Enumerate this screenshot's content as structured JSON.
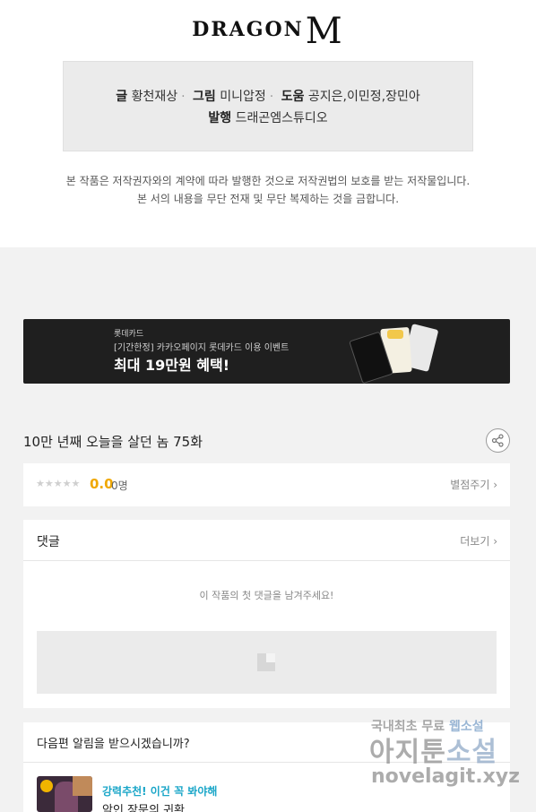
{
  "logo": {
    "text": "DRAGON",
    "mark": "M"
  },
  "credits": {
    "writer_label": "글",
    "writer": "황천재상",
    "art_label": "그림",
    "art": "미니압정",
    "assist_label": "도움",
    "assist": "공지은,이민정,장민아",
    "publisher_label": "발행",
    "publisher": "드래곤엠스튜디오"
  },
  "notice": {
    "line1": "본 작품은 저작권자와의 계약에 따라 발행한 것으로 저작권법의 보호를 받는 저작물입니다.",
    "line2": "본 서의 내용을 무단 전재 및 무단 복제하는 것을 금합니다."
  },
  "banner": {
    "brand": "롯데카드",
    "subtitle": "[기간한정] 카카오페이지 롯데카드 이용 이벤트",
    "headline": "최대 19만원 혜택!"
  },
  "episode": {
    "title": "10만 년째 오늘을 살던 놈 75화",
    "share_icon": "share-icon"
  },
  "rating": {
    "stars": "★★★★★",
    "score": "0.0",
    "count": "0명",
    "rate_label": "별점주기 ›"
  },
  "comments": {
    "title": "댓글",
    "more_label": "더보기 ›",
    "empty_text": "이 작품의 첫 댓글을 남겨주세요!"
  },
  "notify": {
    "question": "다음편 알림을 받으시겠습니까?",
    "recommend_label": "강력추천! 이건 꼭 봐야해",
    "recommend_title": "악인 장문의 귀환"
  },
  "watermark": {
    "line1_a": "국내최초 무료 ",
    "line1_b": "웹소설",
    "line2_a": "아지툰",
    "line2_b": "소설",
    "line3": "novelagit.xyz"
  }
}
